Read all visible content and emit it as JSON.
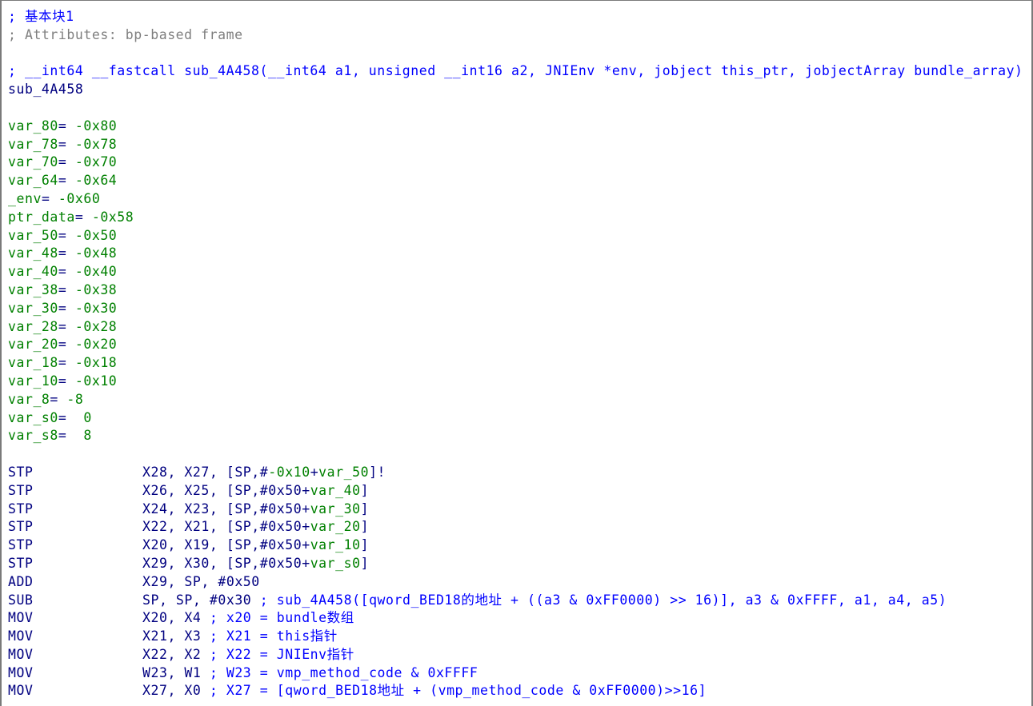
{
  "header": {
    "block_comment": "; 基本块1",
    "attributes_comment": "; Attributes: bp-based frame",
    "prototype_comment": "; __int64 __fastcall sub_4A458(__int64 a1, unsigned __int16 a2, JNIEnv *env, jobject this_ptr, jobjectArray bundle_array)",
    "function_name": "sub_4A458"
  },
  "stack_vars": [
    {
      "name": "var_80",
      "sep": "= ",
      "value": "-0x80"
    },
    {
      "name": "var_78",
      "sep": "= ",
      "value": "-0x78"
    },
    {
      "name": "var_70",
      "sep": "= ",
      "value": "-0x70"
    },
    {
      "name": "var_64",
      "sep": "= ",
      "value": "-0x64"
    },
    {
      "name": "_env",
      "sep": "= ",
      "value": "-0x60"
    },
    {
      "name": "ptr_data",
      "sep": "= ",
      "value": "-0x58"
    },
    {
      "name": "var_50",
      "sep": "= ",
      "value": "-0x50"
    },
    {
      "name": "var_48",
      "sep": "= ",
      "value": "-0x48"
    },
    {
      "name": "var_40",
      "sep": "= ",
      "value": "-0x40"
    },
    {
      "name": "var_38",
      "sep": "= ",
      "value": "-0x38"
    },
    {
      "name": "var_30",
      "sep": "= ",
      "value": "-0x30"
    },
    {
      "name": "var_28",
      "sep": "= ",
      "value": "-0x28"
    },
    {
      "name": "var_20",
      "sep": "= ",
      "value": "-0x20"
    },
    {
      "name": "var_18",
      "sep": "= ",
      "value": "-0x18"
    },
    {
      "name": "var_10",
      "sep": "= ",
      "value": "-0x10"
    },
    {
      "name": "var_8",
      "sep": "= ",
      "value": "-8"
    },
    {
      "name": "var_s0",
      "sep": "=  ",
      "value": "0"
    },
    {
      "name": "var_s8",
      "sep": "=  ",
      "value": "8"
    }
  ],
  "instructions": [
    {
      "mnemonic": "STP",
      "operands": [
        [
          "t",
          "X28, X27, [SP,#"
        ],
        [
          "n",
          "-0x10"
        ],
        [
          "t",
          "+"
        ],
        [
          "v",
          "var_50"
        ],
        [
          "t",
          "]!"
        ]
      ],
      "comment": ""
    },
    {
      "mnemonic": "STP",
      "operands": [
        [
          "t",
          "X26, X25, [SP,#0x50+"
        ],
        [
          "v",
          "var_40"
        ],
        [
          "t",
          "]"
        ]
      ],
      "comment": ""
    },
    {
      "mnemonic": "STP",
      "operands": [
        [
          "t",
          "X24, X23, [SP,#0x50+"
        ],
        [
          "v",
          "var_30"
        ],
        [
          "t",
          "]"
        ]
      ],
      "comment": ""
    },
    {
      "mnemonic": "STP",
      "operands": [
        [
          "t",
          "X22, X21, [SP,#0x50+"
        ],
        [
          "v",
          "var_20"
        ],
        [
          "t",
          "]"
        ]
      ],
      "comment": ""
    },
    {
      "mnemonic": "STP",
      "operands": [
        [
          "t",
          "X20, X19, [SP,#0x50+"
        ],
        [
          "v",
          "var_10"
        ],
        [
          "t",
          "]"
        ]
      ],
      "comment": ""
    },
    {
      "mnemonic": "STP",
      "operands": [
        [
          "t",
          "X29, X30, [SP,#0x50+"
        ],
        [
          "v",
          "var_s0"
        ],
        [
          "t",
          "]"
        ]
      ],
      "comment": ""
    },
    {
      "mnemonic": "ADD",
      "operands": [
        [
          "t",
          "X29, SP, #0x50"
        ]
      ],
      "comment": ""
    },
    {
      "mnemonic": "SUB",
      "operands": [
        [
          "t",
          "SP, SP, #0x30"
        ]
      ],
      "comment": " ; sub_4A458([qword_BED18的地址 + ((a3 & 0xFF0000) >> 16)], a3 & 0xFFFF, a1, a4, a5)"
    },
    {
      "mnemonic": "MOV",
      "operands": [
        [
          "t",
          "X20, X4"
        ]
      ],
      "comment": " ; x20 = bundle数组"
    },
    {
      "mnemonic": "MOV",
      "operands": [
        [
          "t",
          "X21, X3"
        ]
      ],
      "comment": " ; X21 = this指针"
    },
    {
      "mnemonic": "MOV",
      "operands": [
        [
          "t",
          "X22, X2"
        ]
      ],
      "comment": " ; X22 = JNIEnv指针"
    },
    {
      "mnemonic": "MOV",
      "operands": [
        [
          "t",
          "W23, W1"
        ]
      ],
      "comment": " ; W23 = vmp_method_code & 0xFFFF"
    },
    {
      "mnemonic": "MOV",
      "operands": [
        [
          "t",
          "X27, X0"
        ]
      ],
      "comment": " ; X27 = [qword_BED18地址 + (vmp_method_code & 0xFF0000)>>16]"
    }
  ],
  "colors": {
    "comment": "#0000ff",
    "attribute_comment": "#7f7f7f",
    "mnemonic": "#000080",
    "stack_var": "#008000",
    "border": "#7a7a7a"
  }
}
